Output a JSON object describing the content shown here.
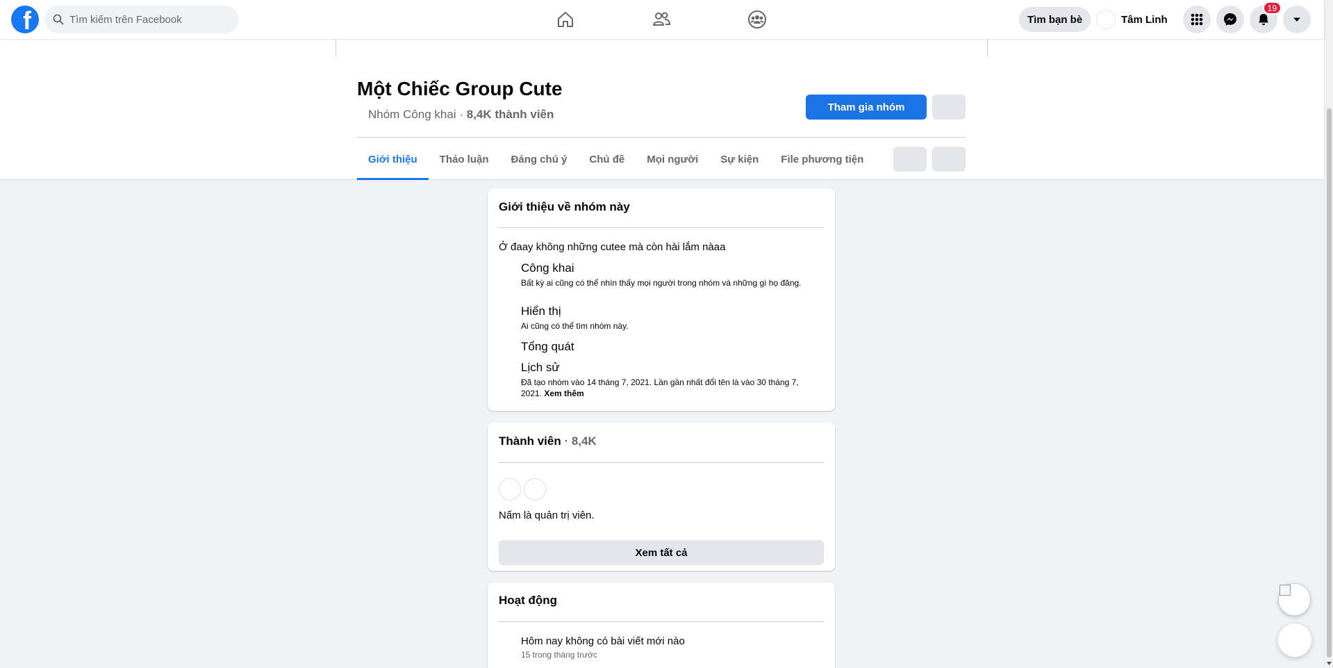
{
  "topbar": {
    "search_placeholder": "Tìm kiếm trên Facebook",
    "find_friends_label": "Tìm bạn bè",
    "profile_name": "Tâm Linh",
    "notifications_count": "19",
    "brand_color": "#1877f2",
    "icons": [
      "facebook-logo",
      "search-icon",
      "home-icon",
      "friends-icon",
      "groups-icon",
      "menu-grid-icon",
      "messenger-icon",
      "bell-icon",
      "caret-down-icon"
    ]
  },
  "group": {
    "name": "Một Chiếc Group Cute",
    "privacy": "Nhóm Công khai",
    "separator": " · ",
    "members": "8,4K thành viên",
    "join_label": "Tham gia nhóm"
  },
  "tabs": [
    {
      "label": "Giới thiệu",
      "active": true
    },
    {
      "label": "Thảo luận",
      "active": false
    },
    {
      "label": "Đáng chú ý",
      "active": false
    },
    {
      "label": "Chủ đề",
      "active": false
    },
    {
      "label": "Mọi người",
      "active": false
    },
    {
      "label": "Sự kiện",
      "active": false
    },
    {
      "label": "File phương tiện",
      "active": false
    }
  ],
  "about": {
    "title": "Giới thiệu về nhóm này",
    "description": "Ở đaay không những cutee mà còn hài lắm nàaa",
    "items": [
      {
        "heading": "Công khai",
        "detail": "Bất kỳ ai cũng có thể nhìn thấy mọi người trong nhóm và những gì họ đăng."
      },
      {
        "heading": "Hiển thị",
        "detail": "Ai cũng có thể tìm nhóm này."
      },
      {
        "heading": "Tổng quát",
        "detail": ""
      },
      {
        "heading": "Lịch sử",
        "detail": "Đã tạo nhóm vào 14 tháng 7, 2021. Lần gần nhất đổi tên là vào 30 tháng 7, 2021.",
        "more": "Xem thêm"
      }
    ]
  },
  "members": {
    "title": "Thành viên",
    "count": " · 8,4K",
    "admin_text": "Nấm là quản trị viên.",
    "see_all_label": "Xem tất cả"
  },
  "activity": {
    "title": "Hoạt động",
    "items": [
      {
        "heading": "Hôm nay không có bài viết mới nào",
        "detail": "15 trong tháng trước"
      }
    ]
  }
}
